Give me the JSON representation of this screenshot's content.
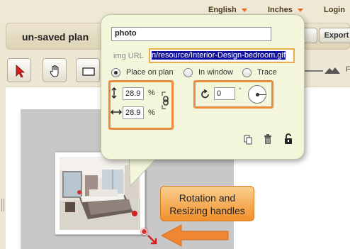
{
  "topbar": {
    "language": "English",
    "units": "Inches",
    "login": "Login"
  },
  "titlebar": {
    "plan_title": "un-saved plan",
    "export_label": "Export"
  },
  "popup": {
    "name_value": "photo",
    "url_label": "img URL",
    "url_value": "n/resource/Interior-Design-bedroom.gif",
    "radio_options": [
      "Place on plan",
      "In window",
      "Trace"
    ],
    "selected_option": "Place on plan",
    "height_percent": "28.9",
    "width_percent": "28.9",
    "percent_unit": "%",
    "rotation_value": "0",
    "degree_symbol": "°"
  },
  "callout": {
    "line1": "Rotation and",
    "line2": "Resizing handles"
  },
  "toolbar": {
    "zoom_letter": "F"
  },
  "colors": {
    "accent_orange": "#ea8a3c",
    "popup_bg": "#f4f6db",
    "callout_fill": "#f5a84a",
    "handle_red": "#dd3333"
  },
  "icons": [
    "pointer-icon",
    "hand-icon",
    "rectangle-icon",
    "height-arrows-icon",
    "width-arrows-icon",
    "link-chain-icon",
    "rotate-icon",
    "copy-icon",
    "trash-icon",
    "unlock-icon"
  ]
}
